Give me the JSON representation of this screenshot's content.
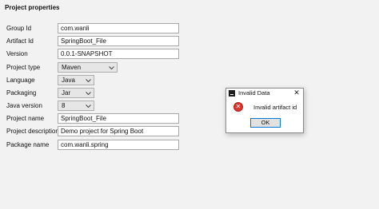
{
  "section_title": "Project properties",
  "fields": {
    "group_id": {
      "label": "Group Id",
      "value": "com.wanli"
    },
    "artifact_id": {
      "label": "Artifact Id",
      "value": "SpringBoot_File"
    },
    "version": {
      "label": "Version",
      "value": "0.0.1-SNAPSHOT"
    },
    "project_type": {
      "label": "Project type",
      "value": "Maven"
    },
    "language": {
      "label": "Language",
      "value": "Java"
    },
    "packaging": {
      "label": "Packaging",
      "value": "Jar"
    },
    "java_version": {
      "label": "Java version",
      "value": "8"
    },
    "project_name": {
      "label": "Project name",
      "value": "SpringBoot_File"
    },
    "project_description": {
      "label": "Project description",
      "value": "Demo project for Spring Boot"
    },
    "package_name": {
      "label": "Package name",
      "value": "com.wanli.spring"
    }
  },
  "dialog": {
    "title": "Invalid Data",
    "close_glyph": "✕",
    "message": "Invalid artifact id",
    "error_glyph": "✕",
    "ok_label": "OK"
  },
  "icons": {
    "dialog_app": "intellij-app-icon",
    "error": "error-icon",
    "dropdown": "chevron-down-icon"
  },
  "colors": {
    "background": "#f2f2f2",
    "error_red": "#e0332c",
    "focus_blue": "#0078d7"
  }
}
